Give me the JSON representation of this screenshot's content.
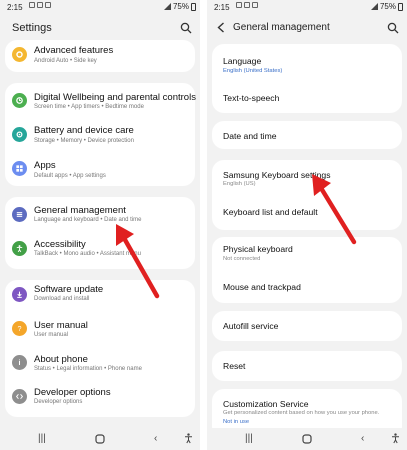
{
  "status": {
    "time": "2:15",
    "battery": "75%"
  },
  "left": {
    "title": "Settings",
    "items": [
      {
        "label": "Advanced features",
        "sub": "Android Auto  •  Side key"
      },
      {
        "label": "Digital Wellbeing and parental controls",
        "sub": "Screen time  •  App timers  •  Bedtime mode"
      },
      {
        "label": "Battery and device care",
        "sub": "Storage  •  Memory  •  Device protection"
      },
      {
        "label": "Apps",
        "sub": "Default apps  •  App settings"
      },
      {
        "label": "General management",
        "sub": "Language and keyboard  •  Date and time"
      },
      {
        "label": "Accessibility",
        "sub": "TalkBack  •  Mono audio  •  Assistant menu"
      },
      {
        "label": "Software update",
        "sub": "Download and install"
      },
      {
        "label": "User manual",
        "sub": "User manual"
      },
      {
        "label": "About phone",
        "sub": "Status  •  Legal information  •  Phone name"
      },
      {
        "label": "Developer options",
        "sub": "Developer options"
      }
    ]
  },
  "right": {
    "title": "General management",
    "items": [
      {
        "label": "Language",
        "sub": "English (United States)"
      },
      {
        "label": "Text-to-speech"
      },
      {
        "label": "Date and time"
      },
      {
        "label": "Samsung Keyboard settings",
        "sub": "English (US)"
      },
      {
        "label": "Keyboard list and default"
      },
      {
        "label": "Physical keyboard",
        "sub": "Not connected"
      },
      {
        "label": "Mouse and trackpad"
      },
      {
        "label": "Autofill service"
      },
      {
        "label": "Reset"
      },
      {
        "label": "Customization Service",
        "sub": "Get personalized content based on how you use your phone.",
        "sub2": "Not in use"
      }
    ]
  },
  "colors": {
    "arrow": "#e02020",
    "link_blue": "#3a6fc8"
  },
  "icons": [
    "gear-icon",
    "wellbeing-icon",
    "battery-care-icon",
    "apps-icon",
    "general-management-icon",
    "accessibility-icon",
    "software-update-icon",
    "user-manual-icon",
    "about-phone-icon",
    "developer-options-icon"
  ]
}
